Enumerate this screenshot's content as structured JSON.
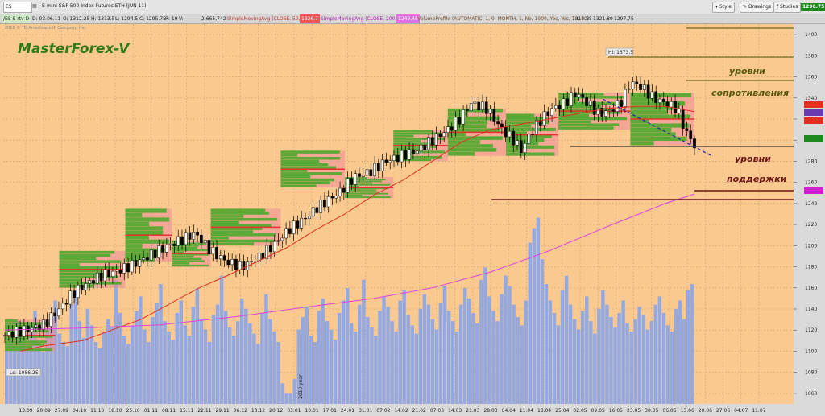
{
  "toolbar": {
    "symbol_box": "ES",
    "window_title": "E-mini S&P 500 Index Futures,ETH (JUN 11)",
    "style_label": "Style",
    "drawings_label": "Drawings",
    "studies_label": "Studies",
    "last_price": "1296.75"
  },
  "status_bar": {
    "symbol_tag": "/ES S rtv D",
    "date": "D: 03.06.11",
    "open": "O: 1312.25",
    "high": "H: 1313.5",
    "low": "L: 1294.5",
    "close": "C: 1295.75",
    "range": "R: 19",
    "vol_label": "V:",
    "volume": "2,665,742",
    "sma50": "SimpleMovingAvg (CLOSE, 50, 0)",
    "sma50_value": "1326.7",
    "sma200": "SimpleMovingAvg (CLOSE, 200, 0)",
    "sma200_value": "1249.48",
    "vp": "VolumeProfile (AUTOMATIC, 1, 0, MONTH, 1, No, 1000, Yes, Yes, 70, 50)",
    "vp_values": [
      "1314.85",
      "1321.89",
      "1297.75"
    ]
  },
  "copyright": "2010 © TD Ameritrade IP Company, Inc.",
  "watermark": "MasterForex-V",
  "annotations": {
    "resistance_1": "уровни",
    "resistance_2": "сопротивления",
    "support_1": "уровни",
    "support_2": "поддержки",
    "hi_label": "Hi: 1373.5",
    "lo_label": "Lo: 1086.25",
    "year_label": "2010 year"
  },
  "colors": {
    "background": "#f9c98f",
    "candle_up": "#ffffff",
    "candle_down": "#000000",
    "sma50": "#e03020",
    "sma200": "#e040e0",
    "volume": "#8ea7e6",
    "profile_green": "#4caa2a",
    "profile_pink": "#f08a9a",
    "resistance_line": "#6b6b1a",
    "support_line": "#6b1515",
    "trend_line": "#2222aa"
  },
  "chart_data": {
    "type": "candlestick",
    "title": "E-mini S&P 500 Index Futures,ETH (JUN 11)",
    "xlabel": "",
    "ylabel": "",
    "ylim": [
      1050,
      1410
    ],
    "grid": true,
    "price_axis_ticks": [
      1060,
      1080,
      1100,
      1120,
      1140,
      1160,
      1180,
      1200,
      1220,
      1240,
      1260,
      1280,
      1300,
      1320,
      1340,
      1360,
      1380,
      1400
    ],
    "date_axis_labels": [
      "13.09",
      "20.09",
      "27.09",
      "04.10",
      "11.10",
      "18.10",
      "25.10",
      "01.11",
      "08.11",
      "15.11",
      "22.11",
      "29.11",
      "06.12",
      "13.12",
      "20.12",
      "03.01",
      "10.01",
      "17.01",
      "24.01",
      "31.01",
      "07.02",
      "14.02",
      "21.02",
      "07.03",
      "14.03",
      "21.03",
      "28.03",
      "04.04",
      "11.04",
      "18.04",
      "25.04",
      "02.05",
      "09.05",
      "16.05",
      "23.05",
      "30.05",
      "06.06",
      "13.06",
      "20.06",
      "27.06",
      "04.07",
      "11.07"
    ],
    "close_path": [
      [
        0,
        1115
      ],
      [
        10,
        1120
      ],
      [
        20,
        1125
      ],
      [
        28,
        1140
      ],
      [
        35,
        1155
      ],
      [
        43,
        1165
      ],
      [
        50,
        1172
      ],
      [
        58,
        1176
      ],
      [
        66,
        1182
      ],
      [
        74,
        1190
      ],
      [
        82,
        1198
      ],
      [
        90,
        1205
      ],
      [
        98,
        1212
      ],
      [
        106,
        1195
      ],
      [
        114,
        1185
      ],
      [
        122,
        1180
      ],
      [
        130,
        1188
      ],
      [
        138,
        1200
      ],
      [
        146,
        1215
      ],
      [
        154,
        1225
      ],
      [
        160,
        1235
      ],
      [
        166,
        1243
      ],
      [
        172,
        1250
      ],
      [
        176,
        1258
      ],
      [
        180,
        1265
      ],
      [
        188,
        1270
      ],
      [
        196,
        1280
      ],
      [
        204,
        1285
      ],
      [
        212,
        1290
      ],
      [
        220,
        1300
      ],
      [
        228,
        1310
      ],
      [
        234,
        1320
      ],
      [
        240,
        1335
      ],
      [
        248,
        1330
      ],
      [
        256,
        1310
      ],
      [
        262,
        1300
      ],
      [
        266,
        1290
      ],
      [
        270,
        1305
      ],
      [
        276,
        1320
      ],
      [
        282,
        1330
      ],
      [
        288,
        1335
      ],
      [
        294,
        1345
      ],
      [
        300,
        1335
      ],
      [
        306,
        1325
      ],
      [
        312,
        1328
      ],
      [
        318,
        1338
      ],
      [
        322,
        1355
      ],
      [
        328,
        1350
      ],
      [
        334,
        1340
      ],
      [
        340,
        1335
      ],
      [
        346,
        1330
      ],
      [
        350,
        1310
      ],
      [
        355,
        1295
      ]
    ],
    "sma50": [
      [
        8,
        1100
      ],
      [
        20,
        1105
      ],
      [
        40,
        1110
      ],
      [
        55,
        1120
      ],
      [
        70,
        1130
      ],
      [
        85,
        1145
      ],
      [
        100,
        1160
      ],
      [
        115,
        1172
      ],
      [
        130,
        1185
      ],
      [
        145,
        1198
      ],
      [
        160,
        1215
      ],
      [
        175,
        1230
      ],
      [
        190,
        1248
      ],
      [
        205,
        1262
      ],
      [
        220,
        1280
      ],
      [
        235,
        1298
      ],
      [
        250,
        1310
      ],
      [
        265,
        1315
      ],
      [
        280,
        1320
      ],
      [
        295,
        1325
      ],
      [
        310,
        1330
      ],
      [
        325,
        1332
      ],
      [
        340,
        1332
      ],
      [
        355,
        1327
      ]
    ],
    "sma200": [
      [
        0,
        1120
      ],
      [
        40,
        1122
      ],
      [
        80,
        1125
      ],
      [
        120,
        1133
      ],
      [
        160,
        1143
      ],
      [
        190,
        1150
      ],
      [
        220,
        1160
      ],
      [
        250,
        1175
      ],
      [
        280,
        1195
      ],
      [
        310,
        1218
      ],
      [
        340,
        1240
      ],
      [
        355,
        1249
      ]
    ],
    "volume_bars_relative": [
      0.3,
      0.35,
      0.28,
      0.4,
      0.33,
      0.26,
      0.38,
      0.45,
      0.3,
      0.25,
      0.36,
      0.42,
      0.5,
      0.34,
      0.3,
      0.28,
      0.48,
      0.55,
      0.4,
      0.32,
      0.46,
      0.38,
      0.3,
      0.27,
      0.35,
      0.41,
      0.37,
      0.6,
      0.44,
      0.33,
      0.29,
      0.38,
      0.45,
      0.52,
      0.36,
      0.3,
      0.42,
      0.49,
      0.58,
      0.4,
      0.35,
      0.31,
      0.44,
      0.5,
      0.38,
      0.33,
      0.47,
      0.56,
      0.41,
      0.36,
      0.3,
      0.43,
      0.48,
      0.62,
      0.45,
      0.37,
      0.33,
      0.4,
      0.51,
      0.46,
      0.39,
      0.34,
      0.29,
      0.44,
      0.53,
      0.41,
      0.35,
      0.3,
      0.1,
      0.05,
      0.05,
      0.12,
      0.36,
      0.42,
      0.47,
      0.33,
      0.3,
      0.45,
      0.51,
      0.4,
      0.36,
      0.31,
      0.44,
      0.5,
      0.56,
      0.39,
      0.35,
      0.48,
      0.6,
      0.42,
      0.37,
      0.33,
      0.45,
      0.52,
      0.47,
      0.4,
      0.35,
      0.5,
      0.55,
      0.43,
      0.38,
      0.34,
      0.46,
      0.53,
      0.48,
      0.41,
      0.36,
      0.49,
      0.57,
      0.45,
      0.4,
      0.35,
      0.48,
      0.56,
      0.51,
      0.44,
      0.39,
      0.6,
      0.66,
      0.52,
      0.45,
      0.4,
      0.53,
      0.62,
      0.57,
      0.48,
      0.42,
      0.38,
      0.5,
      0.78,
      0.85,
      0.9,
      0.7,
      0.58,
      0.5,
      0.44,
      0.38,
      0.55,
      0.62,
      0.48,
      0.41,
      0.36,
      0.45,
      0.52,
      0.4,
      0.34,
      0.46,
      0.55,
      0.48,
      0.42,
      0.37,
      0.44,
      0.5,
      0.39,
      0.35,
      0.41,
      0.47,
      0.43,
      0.36,
      0.4,
      0.48,
      0.52,
      0.44,
      0.38,
      0.35,
      0.46,
      0.5,
      0.41,
      0.55,
      0.58
    ]
  }
}
